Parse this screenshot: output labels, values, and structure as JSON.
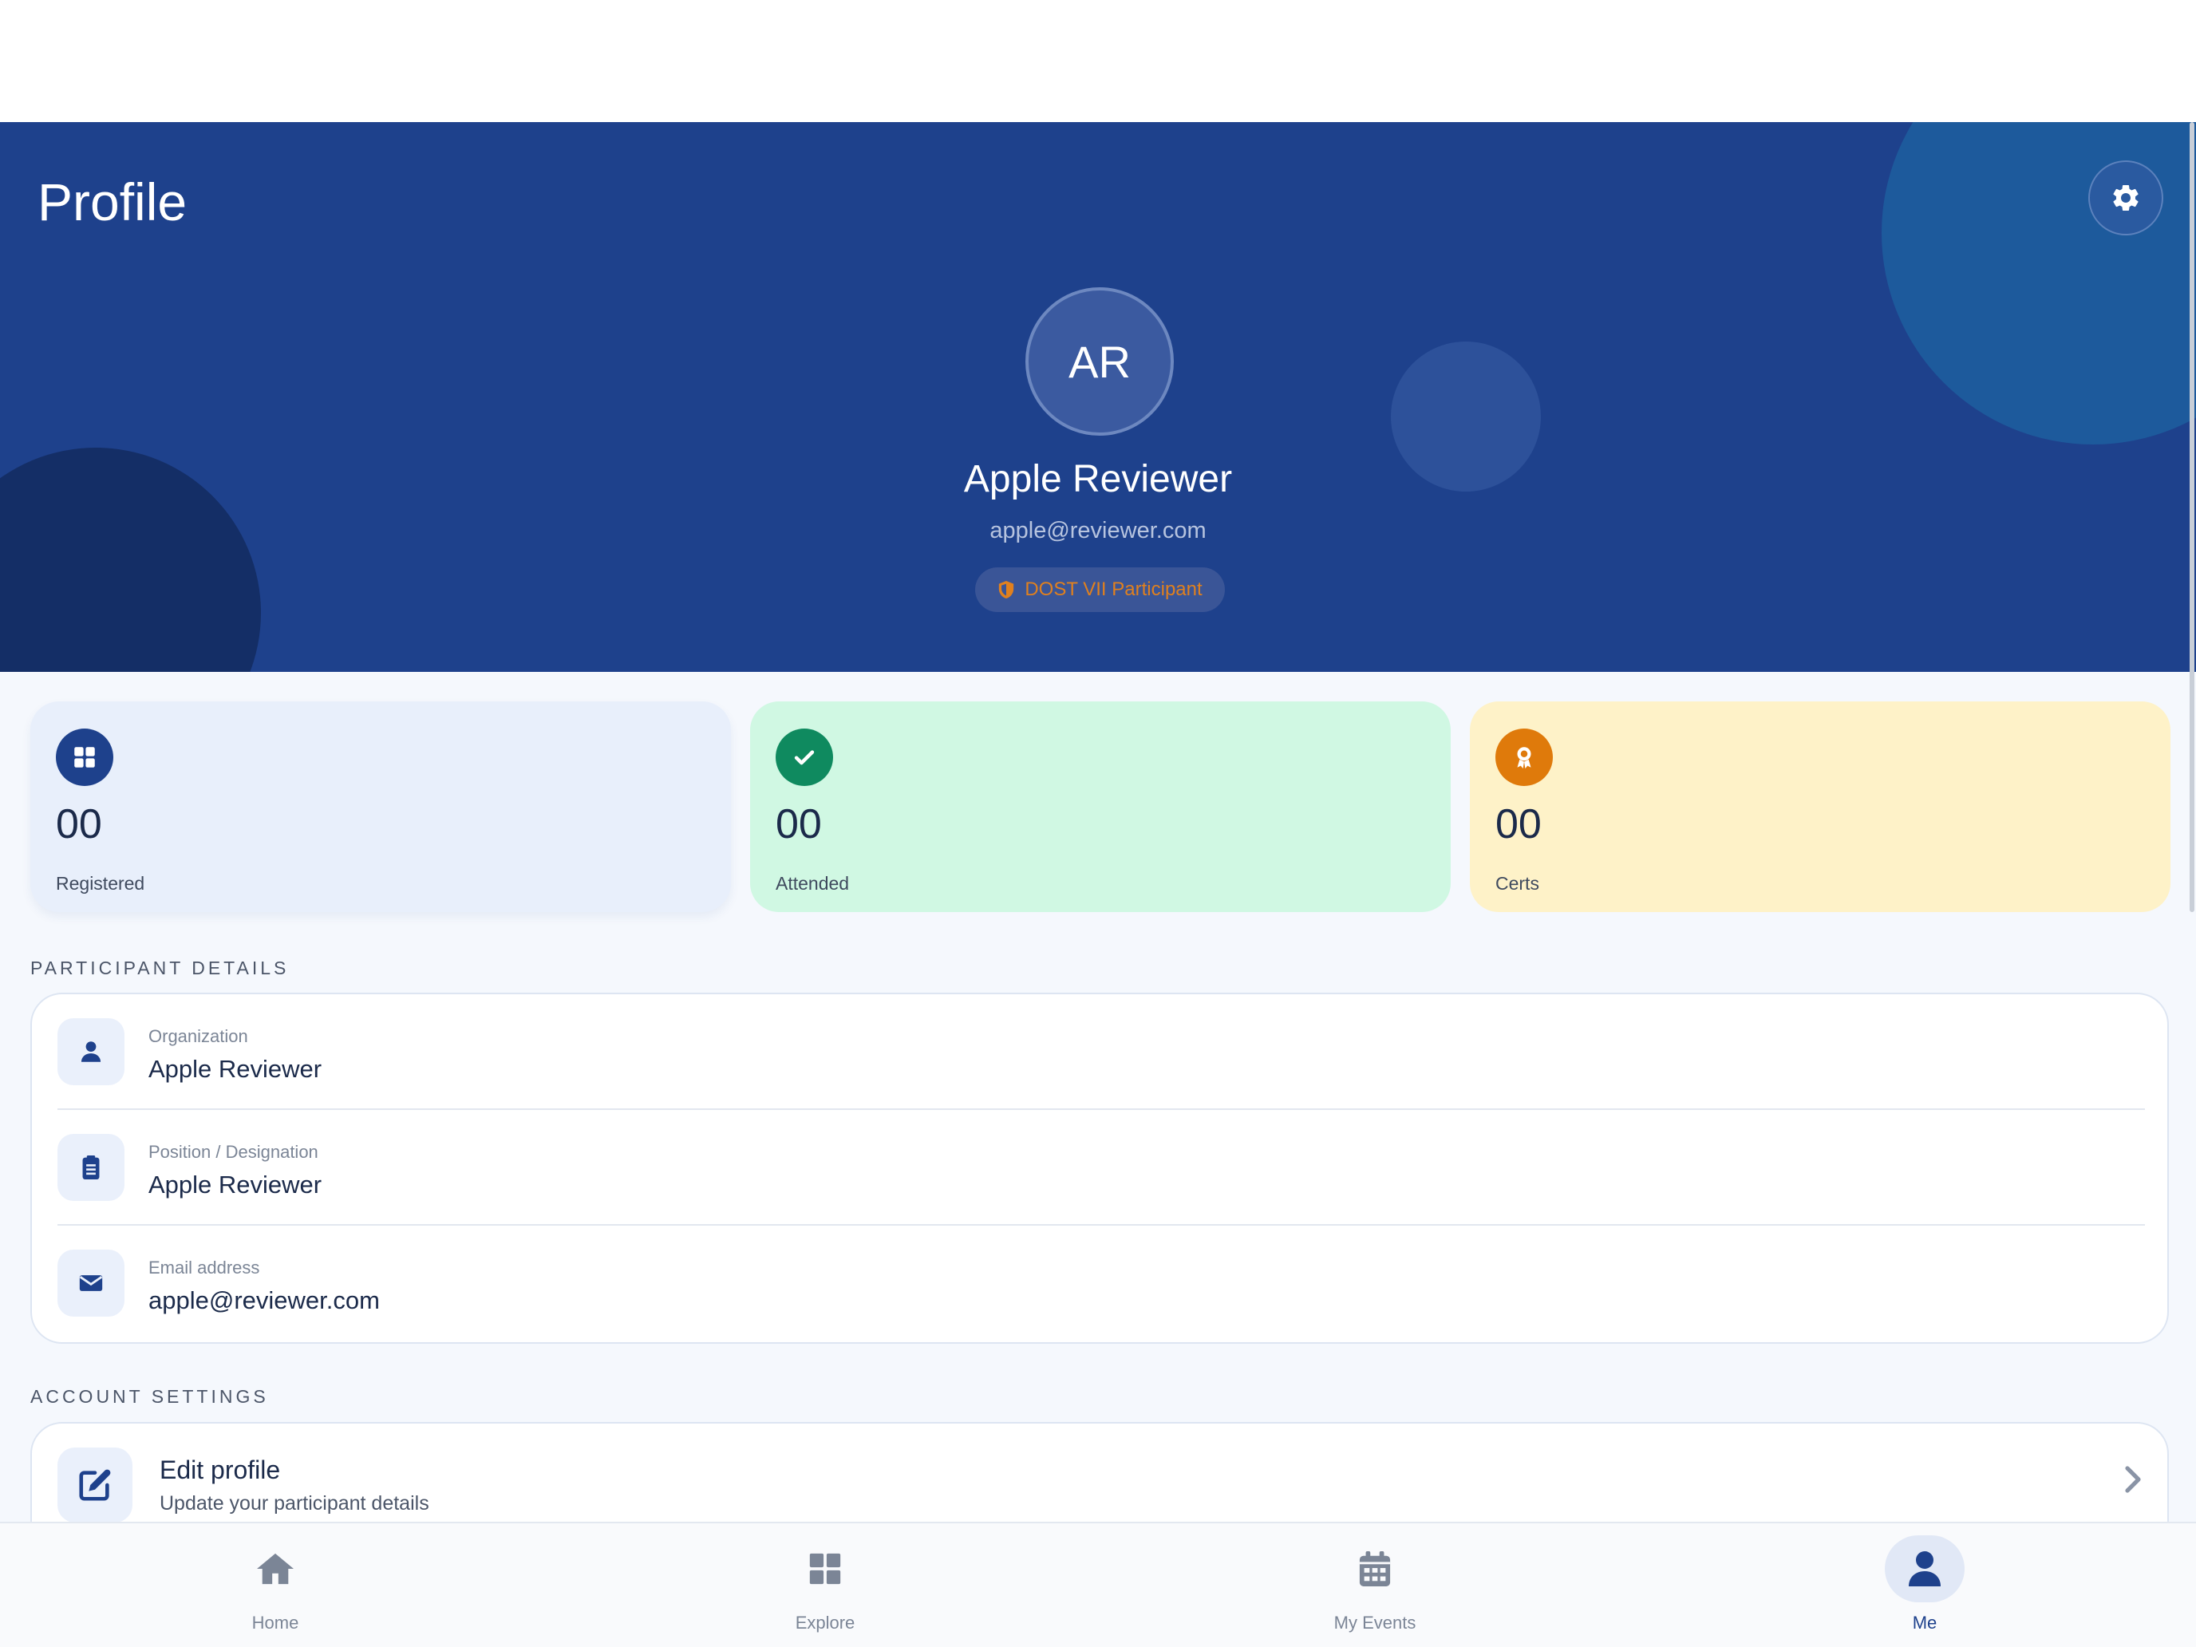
{
  "header": {
    "title": "Profile",
    "avatar_initials": "AR",
    "user_name": "Apple Reviewer",
    "user_email": "apple@reviewer.com",
    "badge_label": "DOST VII Participant",
    "settings_icon": "gear-icon"
  },
  "stats": [
    {
      "value": "00",
      "label": "Registered",
      "icon": "grid-icon",
      "color": "#1e418c"
    },
    {
      "value": "00",
      "label": "Attended",
      "icon": "check-icon",
      "color": "#0f8a5f"
    },
    {
      "value": "00",
      "label": "Certs",
      "icon": "award-icon",
      "color": "#df7a0b"
    }
  ],
  "participant_details": {
    "heading": "PARTICIPANT DETAILS",
    "rows": [
      {
        "label": "Organization",
        "value": "Apple Reviewer",
        "icon": "user-icon"
      },
      {
        "label": "Position / Designation",
        "value": "Apple Reviewer",
        "icon": "clipboard-icon"
      },
      {
        "label": "Email address",
        "value": "apple@reviewer.com",
        "icon": "envelope-icon"
      }
    ]
  },
  "account_settings": {
    "heading": "ACCOUNT SETTINGS",
    "items": [
      {
        "title": "Edit profile",
        "subtitle": "Update your participant details",
        "icon": "edit-icon"
      }
    ]
  },
  "bottom_nav": {
    "items": [
      {
        "label": "Home",
        "icon": "home-icon",
        "active": false
      },
      {
        "label": "Explore",
        "icon": "grid-icon",
        "active": false
      },
      {
        "label": "My Events",
        "icon": "calendar-icon",
        "active": false
      },
      {
        "label": "Me",
        "icon": "user-icon",
        "active": true
      }
    ]
  },
  "colors": {
    "primary": "#1e418c",
    "badge_text": "#e0801e"
  }
}
